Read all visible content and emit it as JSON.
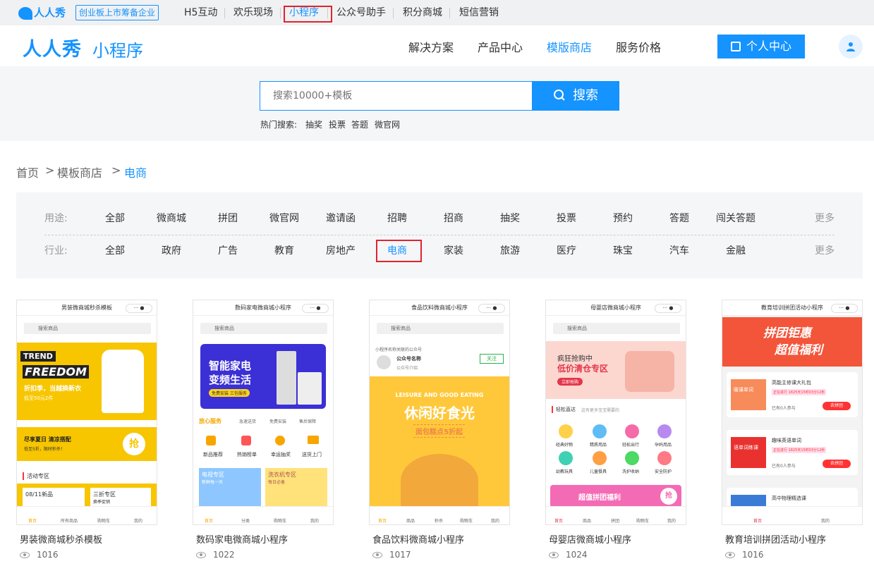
{
  "topbar": {
    "logo": "人人秀",
    "badge": "创业板上市筹备企业",
    "nav": [
      "H5互动",
      "欢乐现场",
      "小程序",
      "公众号助手",
      "积分商城",
      "短信营销"
    ]
  },
  "header": {
    "brand": "人人秀",
    "brand_sub": "小程序",
    "nav": [
      "解决方案",
      "产品中心",
      "模版商店",
      "服务价格"
    ],
    "personal_center": "个人中心"
  },
  "search": {
    "placeholder": "搜索10000+模板",
    "button": "搜索",
    "hot_label": "热门搜索:",
    "hot": [
      "抽奖",
      "投票",
      "答题",
      "微官网"
    ]
  },
  "breadcrumb": [
    "首页",
    ">",
    "模板商店",
    ">",
    "电商"
  ],
  "filter": {
    "usage_label": "用途:",
    "usage": [
      "全部",
      "微商城",
      "拼团",
      "微官网",
      "邀请函",
      "招聘",
      "招商",
      "抽奖",
      "投票",
      "预约",
      "答题",
      "闯关答题"
    ],
    "industry_label": "行业:",
    "industry": [
      "全部",
      "政府",
      "广告",
      "教育",
      "房地产",
      "电商",
      "家装",
      "旅游",
      "医疗",
      "珠宝",
      "汽车",
      "金融"
    ],
    "more": "更多"
  },
  "cards": [
    {
      "title": "男装微商城秒杀模板",
      "views": "1016",
      "phone_title": "男装微商城秒杀模板",
      "search": "搜索商品",
      "banner": [
        "TREND",
        "FREEDOM",
        "折扣季，当越换新衣",
        "低至50元2件"
      ],
      "promo": [
        "尽享夏日 清凉搭配",
        "低至5折，限时秒杀！",
        "抢"
      ],
      "section": "活动专区",
      "items": [
        "08/11新品",
        "三折专区",
        "换季促销"
      ],
      "tabs": [
        "首页",
        "所有商品",
        "购物车",
        "我的"
      ]
    },
    {
      "title": "数码家电微商城小程序",
      "views": "1022",
      "phone_title": "数码家电微商城小程序",
      "search": "搜索商品",
      "banner": [
        "智能家电",
        "变频生活",
        "免费安装 三包服务"
      ],
      "service": [
        "放心服务",
        "急速送货",
        "免费安装",
        "售后保障"
      ],
      "icons": [
        "新品推荐",
        "热销榜单",
        "幸运抽奖",
        "送货上门"
      ],
      "tiles": [
        "电视专区",
        "新鲜每一天",
        "洗衣机专区",
        "每日必备"
      ],
      "tabs": [
        "首页",
        "分类",
        "购物车",
        "我的"
      ]
    },
    {
      "title": "食品饮料微商城小程序",
      "views": "1017",
      "phone_title": "食品饮料微商城小程序",
      "search": "搜索商品",
      "account": [
        "小程序名称关联的公众号",
        "公众号名称",
        "公众号介绍",
        "关注"
      ],
      "banner": [
        "LEISURE AND GOOD EATING",
        "休闲好食光",
        "面包糕点5折起"
      ],
      "tabs": [
        "首页",
        "商品",
        "秒杀",
        "购物车",
        "我的"
      ]
    },
    {
      "title": "母婴店微商城小程序",
      "views": "1024",
      "phone_title": "母婴店微商城小程序",
      "search": "搜索商品",
      "banner": [
        "疯狂抢购中",
        "低价清仓专区",
        "立即抢购"
      ],
      "section": "轻松直达",
      "section_sub": "这有更多宝宝需要的",
      "icons": [
        "经典好物",
        "精质用品",
        "轻松出行",
        "孕妈用品",
        "幼教玩具",
        "儿童餐具",
        "洗护收纳",
        "安全防护"
      ],
      "promo": [
        "超值拼团福利",
        "抢"
      ],
      "tabs": [
        "首页",
        "商品",
        "拼团",
        "购物车",
        "我的"
      ]
    },
    {
      "title": "教育培训拼团活动小程序",
      "views": "1016",
      "phone_title": "教育培训拼团活动小程序",
      "banner": [
        "拼团钜惠",
        "超值福利"
      ],
      "courses": [
        {
          "thumb": "暖课单词",
          "name": "高能主修课大礼包",
          "status": "正在进行 1825天15时03分12秒",
          "count": "已有0人参与",
          "btn": "去拼团"
        },
        {
          "thumb": "语单词练课",
          "name": "趣味英语单词",
          "status": "正在进行 1825天15时03分12秒",
          "count": "已有0人参与",
          "btn": "去拼团"
        },
        {
          "thumb": "",
          "name": "高中物理精选课",
          "status": "",
          "count": "",
          "btn": ""
        }
      ],
      "tabs": [
        "首页",
        "我的"
      ]
    }
  ],
  "colors": {
    "accent": "#1593ff",
    "highlight_box": "#e0242c",
    "band": "#f5f6f8"
  }
}
